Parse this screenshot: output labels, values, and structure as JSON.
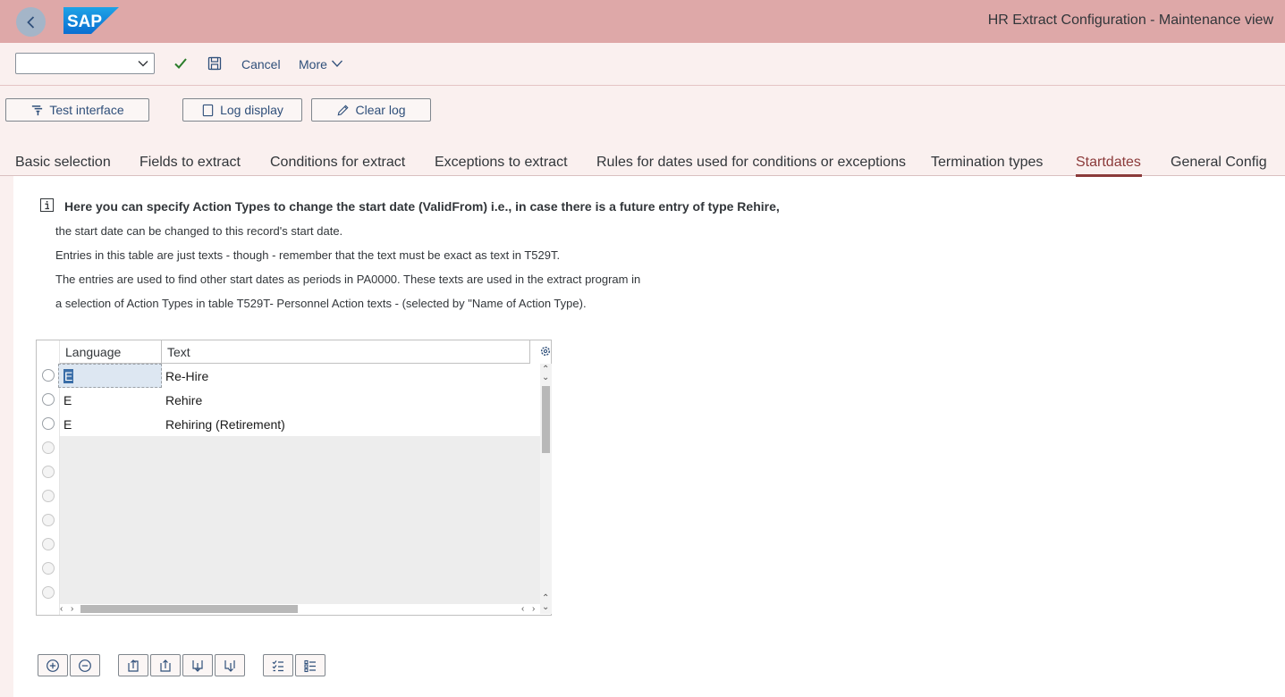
{
  "header": {
    "title": "HR Extract Configuration - Maintenance view",
    "logo_text": "SAP",
    "colors": {
      "shell_bg": "#dea8a8",
      "accent": "#8b3a3a",
      "link": "#2f4f7a"
    }
  },
  "toolbar": {
    "command_value": "",
    "cancel_label": "Cancel",
    "more_label": "More"
  },
  "app_buttons": {
    "test_interface": "Test interface",
    "log_display": "Log display",
    "clear_log": "Clear log"
  },
  "tabs": [
    {
      "label": "Basic selection"
    },
    {
      "label": "Fields to extract"
    },
    {
      "label": "Conditions for extract"
    },
    {
      "label": "Exceptions to extract"
    },
    {
      "label": "Rules for dates used for conditions or exceptions"
    },
    {
      "label": "Termination types"
    },
    {
      "label": "Startdates",
      "active": true
    },
    {
      "label": "General Config"
    }
  ],
  "info": {
    "heading": "Here you can specify Action Types to change the start date (ValidFrom) i.e., in case there is a future entry of type Rehire,",
    "lines": [
      "the start date can be changed to this record's start date.",
      "Entries in this table are just texts - though - remember that the text must be exact as text in T529T.",
      "The entries are used to find other start dates as periods in PA0000. These texts are used in the extract program in",
      "a selection of Action Types in table T529T- Personnel Action texts - (selected by \"Name of Action Type)."
    ]
  },
  "table": {
    "columns": [
      "Language",
      "Text"
    ],
    "rows": [
      {
        "language": "E",
        "text": "Re-Hire"
      },
      {
        "language": "E",
        "text": "Rehire"
      },
      {
        "language": "E",
        "text": "Rehiring (Retirement)"
      }
    ]
  }
}
